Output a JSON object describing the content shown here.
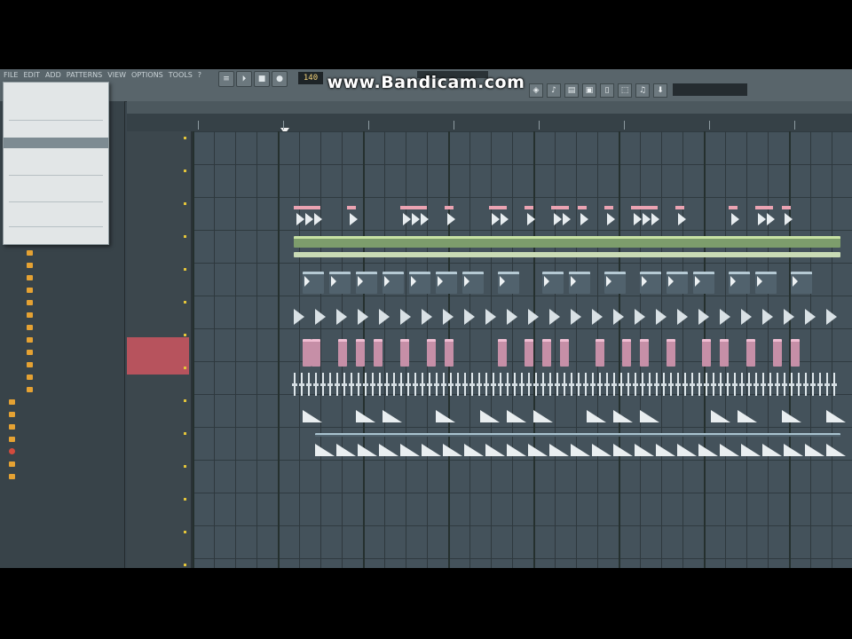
{
  "watermark": "www.Bandicam.com",
  "toolbar": {
    "menus": [
      "FILE",
      "EDIT",
      "ADD",
      "PATTERNS",
      "VIEW",
      "OPTIONS",
      "TOOLS",
      "?"
    ],
    "transport": [
      "≡",
      "⏵",
      "■",
      "●"
    ],
    "tempo": "140",
    "lcd": "",
    "tools": [
      "◈",
      "♪",
      "▤",
      "▣",
      "▯",
      "⬚",
      "♫",
      "⬇"
    ],
    "cpu": ""
  },
  "context_menu": {
    "items": [
      "",
      "",
      "",
      "",
      "",
      "",
      "",
      "",
      "",
      "",
      "",
      "",
      ""
    ],
    "highlighted_index": 4
  },
  "browser": {
    "items": [
      "",
      "",
      "",
      "",
      "",
      "",
      "",
      "",
      "",
      "",
      "",
      "",
      "",
      "",
      "",
      "",
      "",
      "",
      "",
      "",
      "",
      "",
      "",
      ""
    ]
  },
  "playlist": {
    "title": "",
    "selected_track": ""
  },
  "colors": {
    "background": "#3a464d",
    "playlist_grid": "#44525b",
    "selected_track": "#c4545f",
    "clip_header": "#f2a7b4",
    "green_clip": "#7d9d6c",
    "folder": "#e5a233"
  }
}
